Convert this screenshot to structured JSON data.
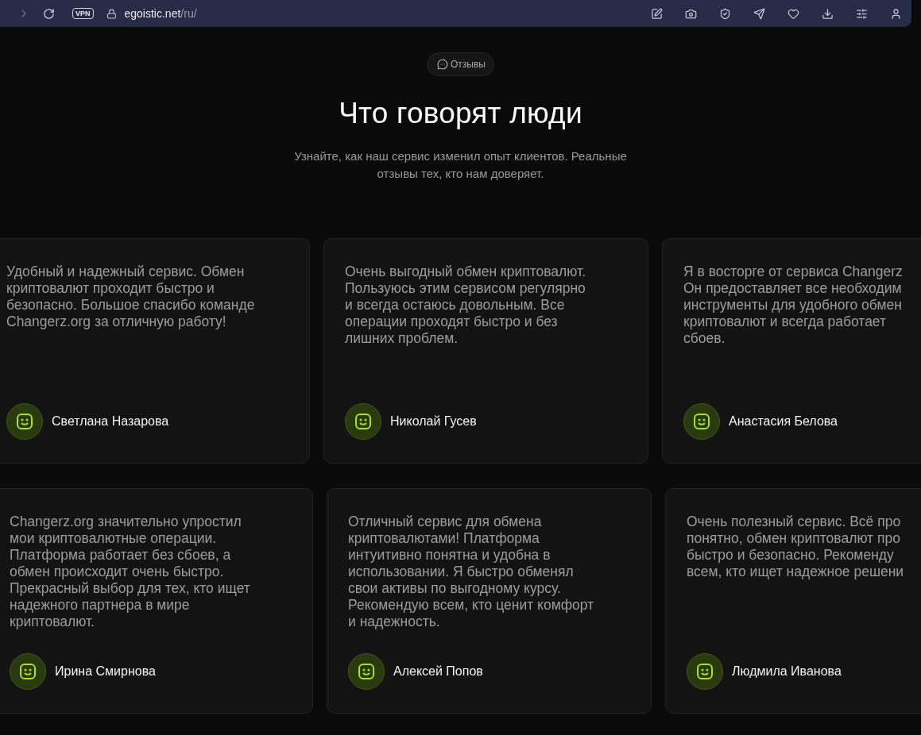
{
  "browser": {
    "vpn_label": "VPN",
    "url_host": "egoistic.net",
    "url_path": "/ru/"
  },
  "section": {
    "badge": "Отзывы",
    "title": "Что говорят люди",
    "subtitle_lines": [
      "Узнайте, как наш сервис изменил опыт клиентов. Реальные",
      "отзывы тех, кто нам доверяет."
    ]
  },
  "review_rows": [
    [
      {
        "lines": [
          "Удобный и надежный сервис. Обмен",
          "криптовалют проходит быстро и",
          "безопасно. Большое спасибо команде",
          "Changerz.org за отличную работу!"
        ],
        "name": "Светлана Назарова"
      },
      {
        "lines": [
          "Очень выгодный обмен криптовалют.",
          "Пользуюсь этим сервисом регулярно",
          "и всегда остаюсь довольным. Все",
          "операции проходят быстро и без",
          "лишних проблем."
        ],
        "name": "Николай Гусев"
      },
      {
        "lines": [
          "Я в восторге от сервиса Changerz",
          "Он предоставляет все необходим",
          "инструменты для удобного обмен",
          "криптовалют и всегда работает",
          "сбоев."
        ],
        "name": "Анастасия Белова"
      }
    ],
    [
      {
        "lines": [
          "Changerz.org значительно упростил",
          "мои криптовалютные операции.",
          "Платформа работает без сбоев, а",
          "обмен происходит очень быстро.",
          "Прекрасный выбор для тех, кто ищет",
          "надежного партнера в мире",
          "криптовалют."
        ],
        "name": "Ирина Смирнова"
      },
      {
        "lines": [
          "Отличный сервис для обмена",
          "криптовалютами! Платформа",
          "интуитивно понятна и удобна в",
          "использовании. Я быстро обменял",
          "свои активы по выгодному курсу.",
          "Рекомендую всем, кто ценит комфорт",
          "и надежность."
        ],
        "name": "Алексей Попов"
      },
      {
        "lines": [
          "Очень полезный сервис. Всё про",
          "понятно, обмен криптовалют про",
          "быстро и безопасно. Рекоменду",
          "всем, кто ищет надежное решени"
        ],
        "name": "Людмила Иванова"
      }
    ]
  ]
}
